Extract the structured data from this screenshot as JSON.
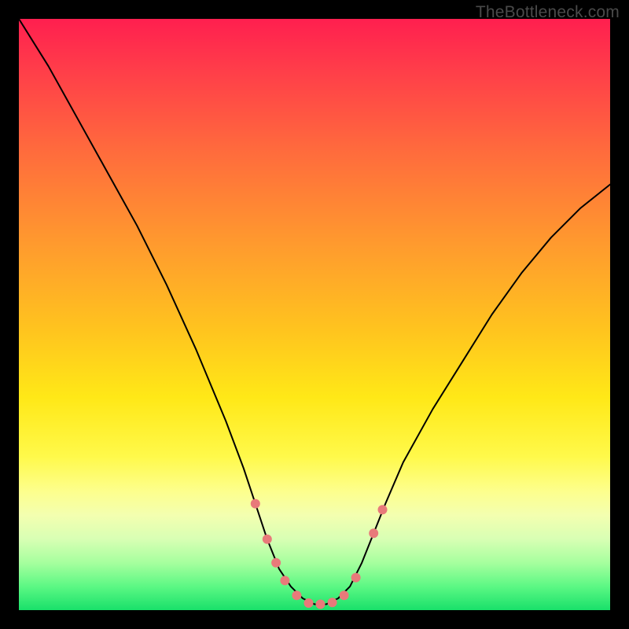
{
  "watermark": {
    "text": "TheBottleneck.com"
  },
  "chart_data": {
    "type": "line",
    "title": "",
    "xlabel": "",
    "ylabel": "",
    "xlim": [
      0,
      100
    ],
    "ylim": [
      0,
      100
    ],
    "series": [
      {
        "name": "curve",
        "x": [
          0,
          5,
          10,
          15,
          20,
          25,
          30,
          35,
          38,
          40,
          42,
          44,
          46,
          48,
          50,
          52,
          54,
          56,
          58,
          60,
          62,
          65,
          70,
          75,
          80,
          85,
          90,
          95,
          100
        ],
        "y": [
          100,
          92,
          83,
          74,
          65,
          55,
          44,
          32,
          24,
          18,
          12,
          7,
          4,
          2,
          1,
          1,
          2,
          4,
          8,
          13,
          18,
          25,
          34,
          42,
          50,
          57,
          63,
          68,
          72
        ],
        "stroke": "#000000",
        "stroke_width": 2
      }
    ],
    "markers": {
      "color": "#e87a7a",
      "radius": 6,
      "points": [
        {
          "x": 40,
          "y": 18
        },
        {
          "x": 42,
          "y": 12
        },
        {
          "x": 43.5,
          "y": 8
        },
        {
          "x": 45,
          "y": 5
        },
        {
          "x": 47,
          "y": 2.5
        },
        {
          "x": 49,
          "y": 1.2
        },
        {
          "x": 51,
          "y": 1
        },
        {
          "x": 53,
          "y": 1.3
        },
        {
          "x": 55,
          "y": 2.5
        },
        {
          "x": 57,
          "y": 5.5
        },
        {
          "x": 60,
          "y": 13
        },
        {
          "x": 61.5,
          "y": 17
        }
      ]
    },
    "background_gradient": {
      "direction": "vertical",
      "stops": [
        {
          "pos": 0.0,
          "color": "#ff1f4f"
        },
        {
          "pos": 0.38,
          "color": "#ff9a2e"
        },
        {
          "pos": 0.74,
          "color": "#fff94a"
        },
        {
          "pos": 1.0,
          "color": "#19e06a"
        }
      ]
    }
  }
}
